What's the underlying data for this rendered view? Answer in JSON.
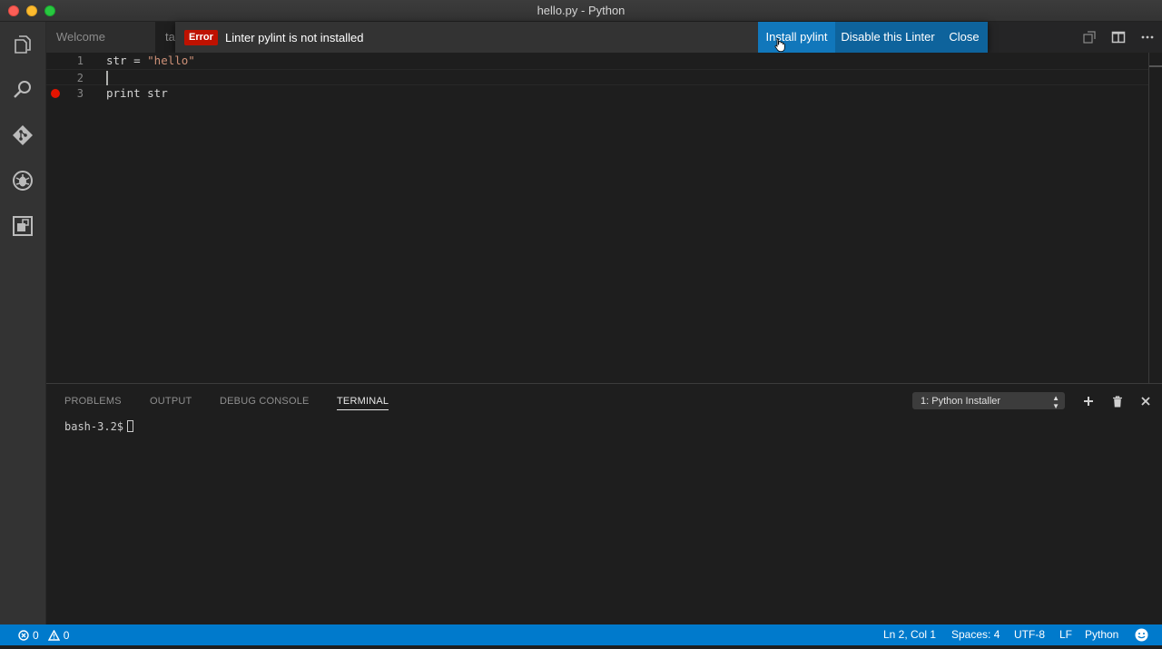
{
  "window": {
    "title": "hello.py - Python"
  },
  "tabs": [
    {
      "label": "Welcome"
    },
    {
      "label": "ta"
    }
  ],
  "notification": {
    "severity": "Error",
    "message": "Linter pylint is not installed",
    "actions": [
      "Install pylint",
      "Disable this Linter",
      "Close"
    ]
  },
  "editor": {
    "lines": [
      {
        "number": "1",
        "code_prefix": "str = ",
        "code_string": "\"hello\""
      },
      {
        "number": "2",
        "code_prefix": "",
        "code_string": ""
      },
      {
        "number": "3",
        "code_prefix": "print str",
        "code_string": "",
        "breakpoint": true
      }
    ]
  },
  "panel": {
    "tabs": [
      "PROBLEMS",
      "OUTPUT",
      "DEBUG CONSOLE",
      "TERMINAL"
    ],
    "active_tab": "TERMINAL",
    "terminal_selector": "1: Python Installer",
    "prompt": "bash-3.2$"
  },
  "statusbar": {
    "errors": "0",
    "warnings": "0",
    "position": "Ln 2, Col 1",
    "spaces": "Spaces: 4",
    "encoding": "UTF-8",
    "eol": "LF",
    "language": "Python"
  },
  "colors": {
    "accent": "#007acc",
    "error_badge": "#be1100",
    "button": "#0e639c"
  }
}
